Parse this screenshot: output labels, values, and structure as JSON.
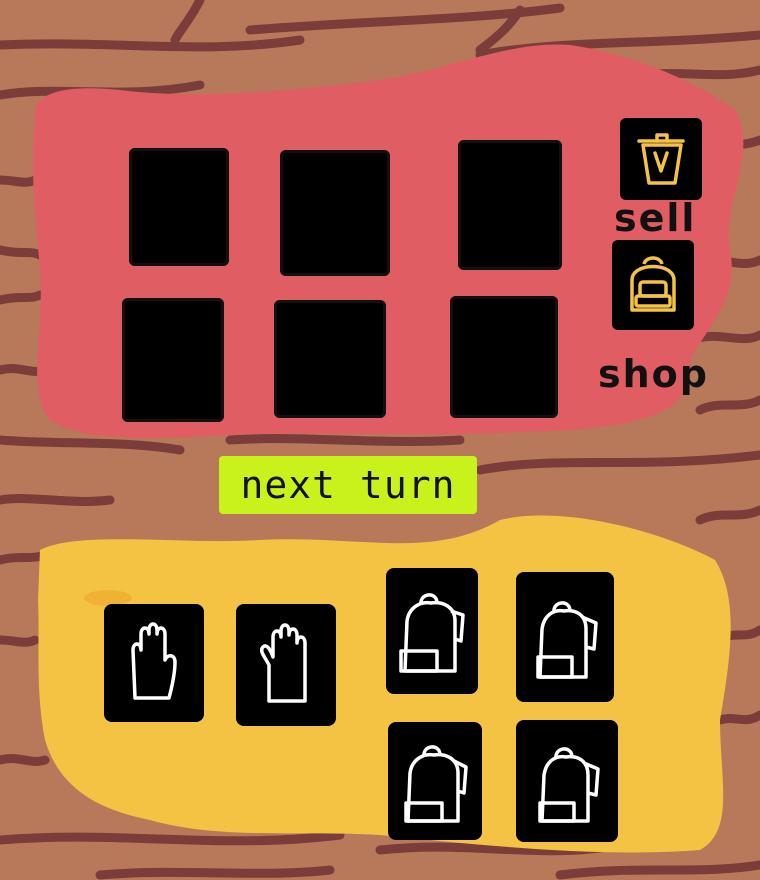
{
  "colors": {
    "wood": "#b7795a",
    "wood_grain": "#7a3d3a",
    "shop_panel": "#e05d63",
    "hand_panel": "#f5c343",
    "next_turn_bg": "#c9f21c",
    "icon_gold": "#f5c343",
    "icon_white": "#ffffff",
    "slot": "#000000"
  },
  "shop_panel": {
    "slot_count": 6,
    "slots": [
      "",
      "",
      "",
      "",
      "",
      ""
    ],
    "sell": {
      "icon": "trash-can-icon",
      "label": "sell"
    },
    "shop": {
      "icon": "backpack-icon",
      "label": "shop"
    }
  },
  "next_turn": {
    "label": "next turn"
  },
  "hand_panel": {
    "hands": [
      {
        "icon": "hand-icon"
      },
      {
        "icon": "hand-icon"
      }
    ],
    "backpacks": [
      {
        "icon": "backpack-icon"
      },
      {
        "icon": "backpack-icon"
      },
      {
        "icon": "backpack-icon"
      },
      {
        "icon": "backpack-icon"
      }
    ]
  }
}
